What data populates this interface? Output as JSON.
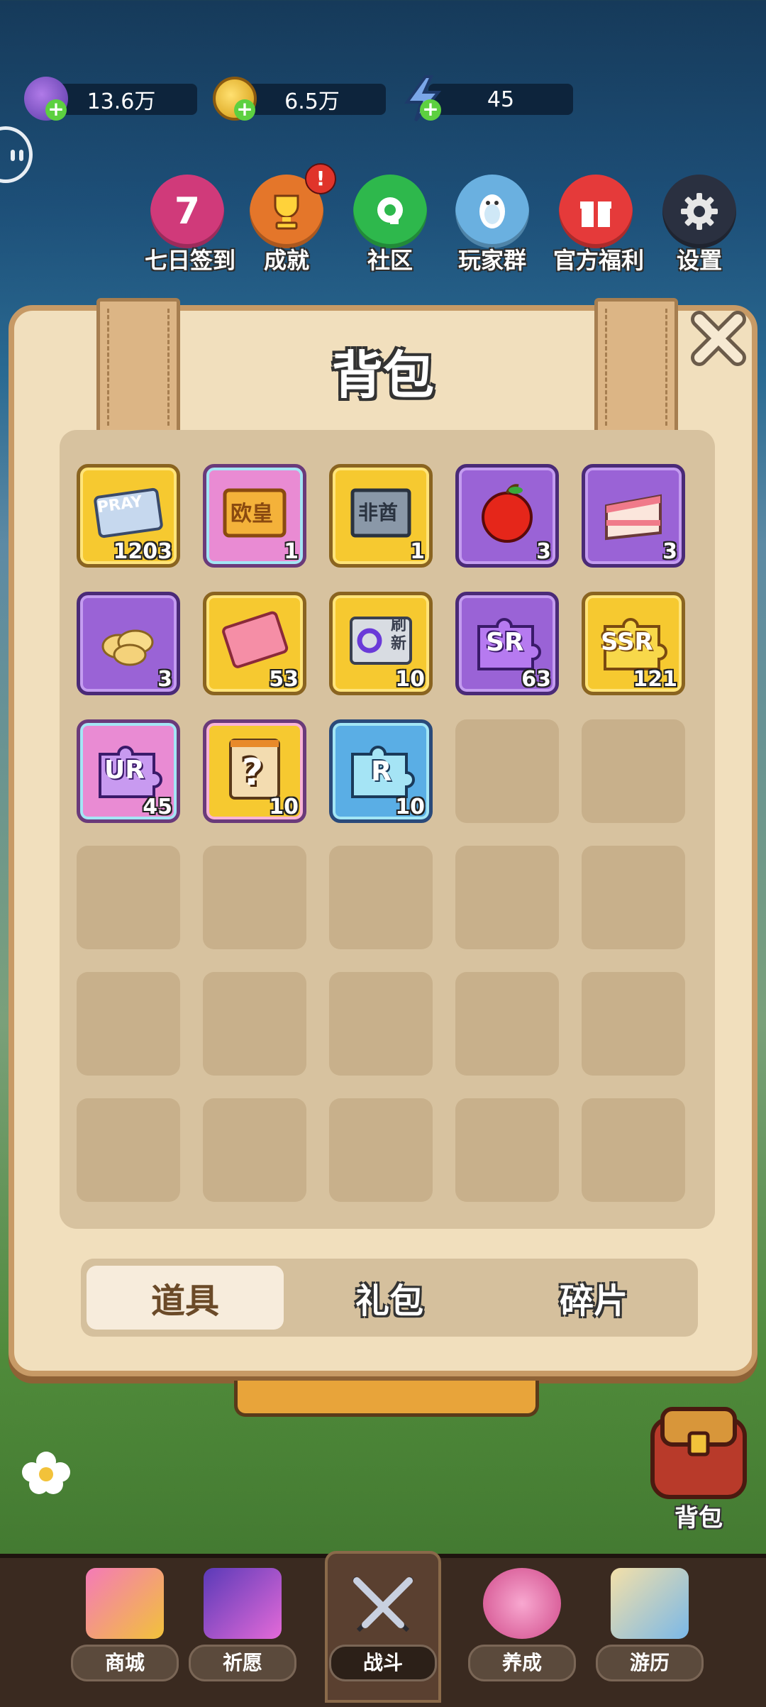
{
  "currencies": [
    {
      "icon": "gem-icon",
      "value": "13.6万"
    },
    {
      "icon": "coin-icon",
      "value": "6.5万"
    },
    {
      "icon": "energy-icon",
      "value": "45"
    }
  ],
  "top_menu": [
    {
      "label": "七日签到",
      "icon": "seven-day-icon",
      "glyph": "7"
    },
    {
      "label": "成就",
      "icon": "trophy-icon",
      "badge": "!"
    },
    {
      "label": "社区",
      "icon": "community-icon"
    },
    {
      "label": "玩家群",
      "icon": "penguin-icon"
    },
    {
      "label": "官方福利",
      "icon": "gift-icon"
    },
    {
      "label": "设置",
      "icon": "gear-icon"
    }
  ],
  "panel": {
    "title": "背包"
  },
  "items": [
    {
      "name": "pray-ticket",
      "text": "PRAY",
      "count": "1203",
      "frame": "gold"
    },
    {
      "name": "ouhuang-ticket",
      "text": "欧皇",
      "count": "1",
      "frame": "pink"
    },
    {
      "name": "fei-ticket",
      "text": "非酋",
      "count": "1",
      "frame": "gold"
    },
    {
      "name": "apple",
      "count": "3",
      "frame": "purple"
    },
    {
      "name": "cake",
      "count": "3",
      "frame": "purple"
    },
    {
      "name": "chips",
      "count": "3",
      "frame": "purple"
    },
    {
      "name": "pink-ticket",
      "count": "53",
      "frame": "gold"
    },
    {
      "name": "refresh-ticket",
      "text": "刷新",
      "count": "10",
      "frame": "gold"
    },
    {
      "name": "sr-fragment",
      "text": "SR",
      "count": "63",
      "frame": "purple"
    },
    {
      "name": "ssr-fragment",
      "text": "SSR",
      "count": "121",
      "frame": "gold"
    },
    {
      "name": "ur-fragment",
      "text": "UR",
      "count": "45",
      "frame": "pink"
    },
    {
      "name": "mystery-pack",
      "text": "?",
      "count": "10",
      "frame": "pink"
    },
    {
      "name": "r-fragment",
      "text": "R",
      "count": "10",
      "frame": "blue"
    }
  ],
  "tabs": [
    {
      "label": "道具",
      "active": true
    },
    {
      "label": "礼包",
      "active": false
    },
    {
      "label": "碎片",
      "active": false
    }
  ],
  "backpack_button": {
    "label": "背包"
  },
  "bottom_nav": [
    {
      "label": "商城",
      "active": false
    },
    {
      "label": "祈愿",
      "active": false
    },
    {
      "label": "战斗",
      "active": true
    },
    {
      "label": "养成",
      "active": false
    },
    {
      "label": "游历",
      "active": false
    }
  ],
  "colors": {
    "panel": "#f1dfbd",
    "panel_border": "#c79a66",
    "gold_frame": "#f6c930",
    "purple_frame": "#9a63d6"
  }
}
